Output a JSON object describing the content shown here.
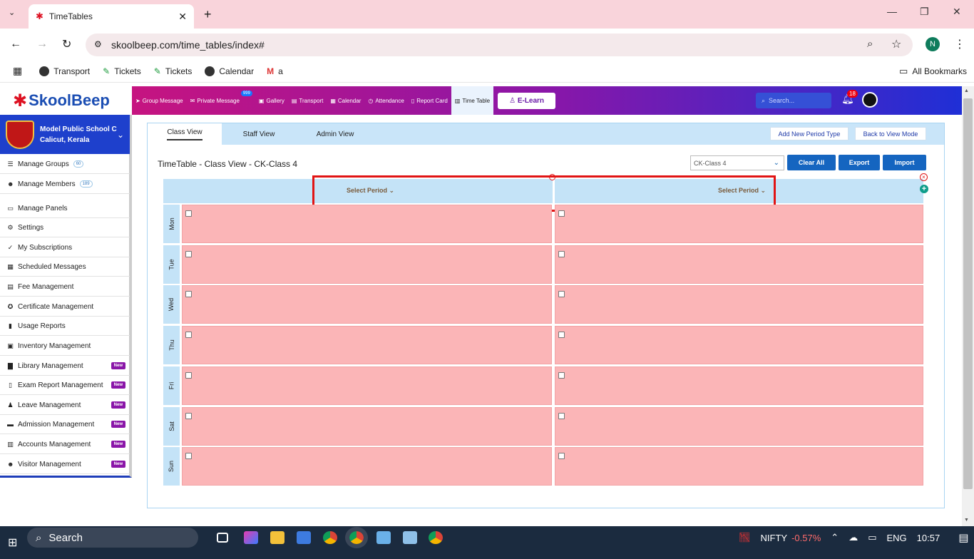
{
  "browser": {
    "tab_title": "TimeTables",
    "url": "skoolbeep.com/time_tables/index#",
    "profile_initial": "N",
    "bookmarks": [
      "Transport",
      "Tickets",
      "Tickets",
      "Calendar",
      "a"
    ],
    "all_bookmarks": "All Bookmarks"
  },
  "app": {
    "logo_text": "SkoolBeep",
    "nav": [
      {
        "label": "Group Message",
        "icon": "send-icon"
      },
      {
        "label": "Private Message",
        "icon": "mail-icon",
        "badge": "999"
      },
      {
        "label": "Gallery",
        "icon": "image-icon"
      },
      {
        "label": "Transport",
        "icon": "bus-icon"
      },
      {
        "label": "Calendar",
        "icon": "calendar-icon"
      },
      {
        "label": "Attendance",
        "icon": "clock-icon"
      },
      {
        "label": "Report Card",
        "icon": "document-icon"
      },
      {
        "label": "Time Table",
        "icon": "timetable-icon"
      }
    ],
    "elearn": "E-Learn",
    "search_placeholder": "Search...",
    "notifications": "18"
  },
  "sidebar": {
    "school_name": "Model Public School C",
    "school_location": "Calicut, Kerala",
    "items": [
      {
        "label": "Manage Groups",
        "count": "60",
        "icon": "list-icon"
      },
      {
        "label": "Manage Members",
        "count": "189",
        "icon": "users-icon"
      },
      {
        "label": "Manage Panels",
        "icon": "monitor-icon"
      },
      {
        "label": "Settings",
        "icon": "gear-icon"
      },
      {
        "label": "My Subscriptions",
        "icon": "check-icon"
      },
      {
        "label": "Scheduled Messages",
        "icon": "calendar-icon"
      },
      {
        "label": "Fee Management",
        "icon": "receipt-icon"
      },
      {
        "label": "Certificate Management",
        "icon": "award-icon"
      },
      {
        "label": "Usage Reports",
        "icon": "bar-chart-icon"
      },
      {
        "label": "Inventory Management",
        "icon": "box-icon"
      },
      {
        "label": "Library Management",
        "new": "New",
        "icon": "book-icon"
      },
      {
        "label": "Exam Report Management",
        "new": "New",
        "icon": "file-icon"
      },
      {
        "label": "Leave Management",
        "new": "New",
        "icon": "person-icon"
      },
      {
        "label": "Admission Management",
        "new": "New",
        "icon": "id-card-icon"
      },
      {
        "label": "Accounts Management",
        "new": "New",
        "icon": "ledger-icon"
      },
      {
        "label": "Visitor Management",
        "new": "New",
        "icon": "users-icon"
      }
    ]
  },
  "main": {
    "tabs": [
      "Class View",
      "Staff View",
      "Admin View"
    ],
    "add_period_type": "Add New Period Type",
    "back_to_view": "Back to View Mode",
    "title": "TimeTable - Class View - CK-Class 4",
    "class_select": "CK-Class 4",
    "clear_all": "Clear All",
    "export": "Export",
    "import": "Import",
    "period_headers": [
      "Select Period",
      "Select Period"
    ],
    "days": [
      "Mon",
      "Tue",
      "Wed",
      "Thu",
      "Fri",
      "Sat",
      "Sun"
    ]
  },
  "taskbar": {
    "search": "Search",
    "ticker": "NIFTY",
    "ticker_change": "-0.57%",
    "lang": "ENG",
    "time": "10:57"
  },
  "colors": {
    "accent_blue": "#1565c0",
    "cell_pink": "#fbb5b7",
    "header_blue": "#c4e3f7",
    "highlight_red": "#e11414",
    "new_badge": "#8a16a8"
  }
}
